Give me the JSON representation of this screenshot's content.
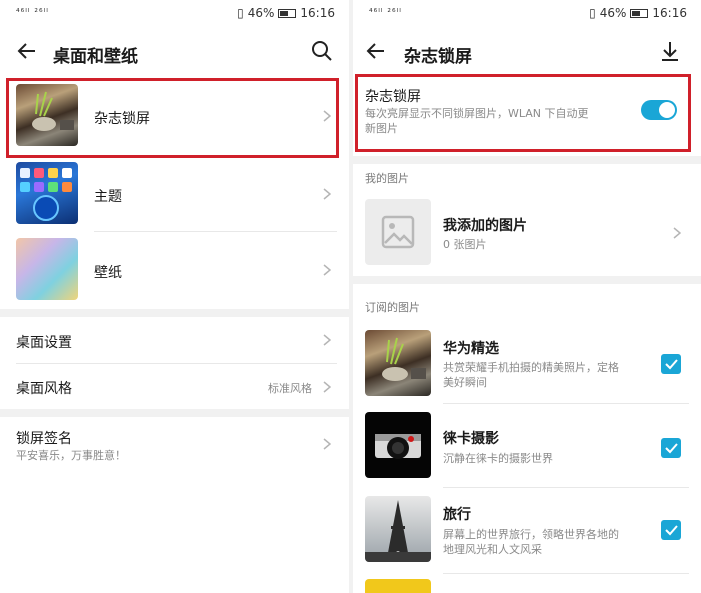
{
  "left": {
    "status": {
      "signal": "⁴⁶ᴵᴵ ²⁶ᴵᴵ",
      "battery": "46%",
      "time": "16:16"
    },
    "header": {
      "title": "桌面和壁纸"
    },
    "items": [
      {
        "label": "杂志锁屏"
      },
      {
        "label": "主题"
      },
      {
        "label": "壁纸"
      }
    ],
    "settings": [
      {
        "label": "桌面设置",
        "value": ""
      },
      {
        "label": "桌面风格",
        "value": "标准风格"
      }
    ],
    "signature": {
      "label": "锁屏签名",
      "value": "平安喜乐，万事胜意！"
    },
    "icons": {
      "back": "back-arrow-icon",
      "search": "search-icon",
      "chevron": "chevron-right-icon"
    }
  },
  "right": {
    "status": {
      "signal": "⁴⁶ᴵᴵ ²⁶ᴵᴵ",
      "battery": "46%",
      "time": "16:16"
    },
    "header": {
      "title": "杂志锁屏"
    },
    "magazine": {
      "label": "杂志锁屏",
      "description_line1": "每次亮屏显示不同锁屏图片，WLAN 下自动更",
      "description_line2": "新图片",
      "enabled": true
    },
    "my_pictures": {
      "section_title": "我的图片",
      "label": "我添加的图片",
      "count": "0 张图片"
    },
    "subscribed": {
      "section_title": "订阅的图片",
      "items": [
        {
          "label": "华为精选",
          "desc1": "共赏荣耀手机拍摄的精美照片，定格",
          "desc2": "美好瞬间",
          "checked": true
        },
        {
          "label": "徕卡摄影",
          "desc1": "沉静在徕卡的摄影世界",
          "desc2": "",
          "checked": true
        },
        {
          "label": "旅行",
          "desc1": "屏幕上的世界旅行，领略世界各地的",
          "desc2": "地理风光和人文风采",
          "checked": true
        }
      ]
    },
    "icons": {
      "back": "back-arrow-icon",
      "download": "download-icon",
      "chevron": "chevron-right-icon",
      "image": "image-placeholder-icon",
      "check": "checkmark-icon"
    },
    "colors": {
      "accent": "#1aa6d6",
      "highlight_box": "#d0202a"
    }
  }
}
